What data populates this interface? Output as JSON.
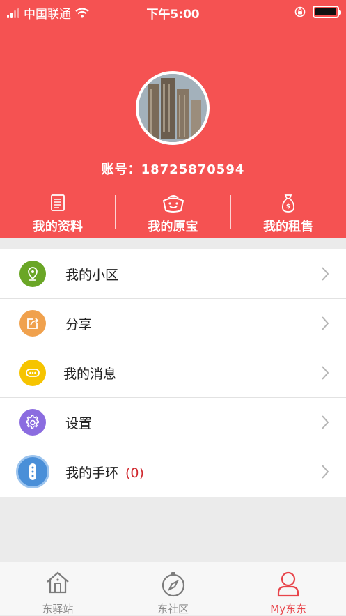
{
  "status_bar": {
    "carrier": "中国联通",
    "time": "下午5:00"
  },
  "profile": {
    "account_label": "账号：",
    "account_number": "18725870594"
  },
  "quick_actions": [
    {
      "label": "我的资料",
      "icon": "document-icon"
    },
    {
      "label": "我的原宝",
      "icon": "smiley-bag-icon"
    },
    {
      "label": "我的租售",
      "icon": "money-bag-icon"
    }
  ],
  "menu": [
    {
      "label": "我的小区",
      "icon": "location-pin-icon",
      "color": "#6aa626"
    },
    {
      "label": "分享",
      "icon": "share-icon",
      "color": "#f0a14d"
    },
    {
      "label": "我的消息",
      "icon": "chat-bubble-icon",
      "color": "#f6c400"
    },
    {
      "label": "设置",
      "icon": "gear-icon",
      "color": "#8b6ce0"
    },
    {
      "label": "我的手环",
      "count": "(0)",
      "icon": "wristband-icon",
      "color": "#4a8fd8"
    }
  ],
  "tabs": [
    {
      "label": "东驿站",
      "icon": "house-icon",
      "active": false
    },
    {
      "label": "东社区",
      "icon": "compass-icon",
      "active": false
    },
    {
      "label": "My东东",
      "icon": "person-icon",
      "active": true
    }
  ]
}
